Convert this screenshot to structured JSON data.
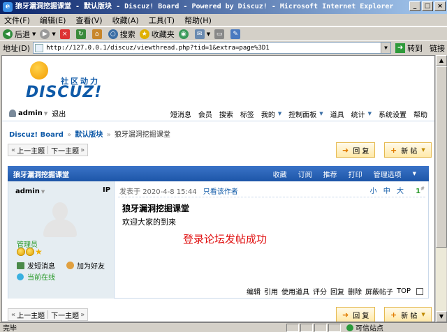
{
  "window": {
    "title": "狼牙漏洞挖掘课堂 - 默认版块 - Discuz! Board - Powered by Discuz! - Microsoft Internet Explorer",
    "buttons": [
      "_",
      "□",
      "×"
    ]
  },
  "menu": [
    "文件(F)",
    "编辑(E)",
    "查看(V)",
    "收藏(A)",
    "工具(T)",
    "帮助(H)"
  ],
  "toolbar": {
    "back": "后退",
    "search": "搜索",
    "favorites": "收藏夹"
  },
  "address": {
    "label": "地址(D)",
    "url": "http://127.0.0.1/discuz/viewthread.php?tid=1&extra=page%3D1",
    "go": "转到",
    "links": "链接"
  },
  "site": {
    "logo_cn": "社区动力",
    "logo_en": "DISCUZ!",
    "user": "admin",
    "logout": "退出",
    "nav": [
      "短消息",
      "会员",
      "搜索",
      "标签",
      "我的",
      "控制面板",
      "道具",
      "统计",
      "系统设置",
      "帮助"
    ]
  },
  "breadcrumb": {
    "home": "Discuz! Board",
    "forum": "默认版块",
    "thread": "狼牙漏洞挖掘课堂",
    "sep": "»"
  },
  "pager": {
    "prev": "上一主题",
    "next": "下一主题",
    "lt": "«",
    "gt": "»"
  },
  "actions": {
    "reply": "回 复",
    "newthread": "新 帖"
  },
  "thread": {
    "title": "狼牙漏洞挖掘课堂",
    "ops": [
      "收藏",
      "订阅",
      "推荐",
      "打印",
      "管理选项"
    ]
  },
  "post": {
    "author": "admin",
    "ip": "IP",
    "role": "管理员",
    "pm": "发短消息",
    "addfriend": "加为好友",
    "online": "当前在线",
    "meta_prefix": "发表于",
    "time": "2020-4-8 15:44",
    "only_author": "只看该作者",
    "font_sizes": [
      "小",
      "中",
      "大"
    ],
    "floor": "1",
    "floor_sup": "#",
    "subject": "狼牙漏洞挖掘课堂",
    "body": "欢迎大家的到来",
    "note": "登录论坛发帖成功",
    "foot": [
      "编辑",
      "引用",
      "使用道具",
      "评分",
      "回复",
      "删除",
      "屏蔽帖子",
      "TOP"
    ]
  },
  "status": {
    "text": "完毕",
    "zone": "可信站点"
  },
  "colors": {
    "accent": "#1d56a8",
    "link": "#0f5aa8",
    "note": "#e01010",
    "author_bg": "#e5edf2"
  }
}
